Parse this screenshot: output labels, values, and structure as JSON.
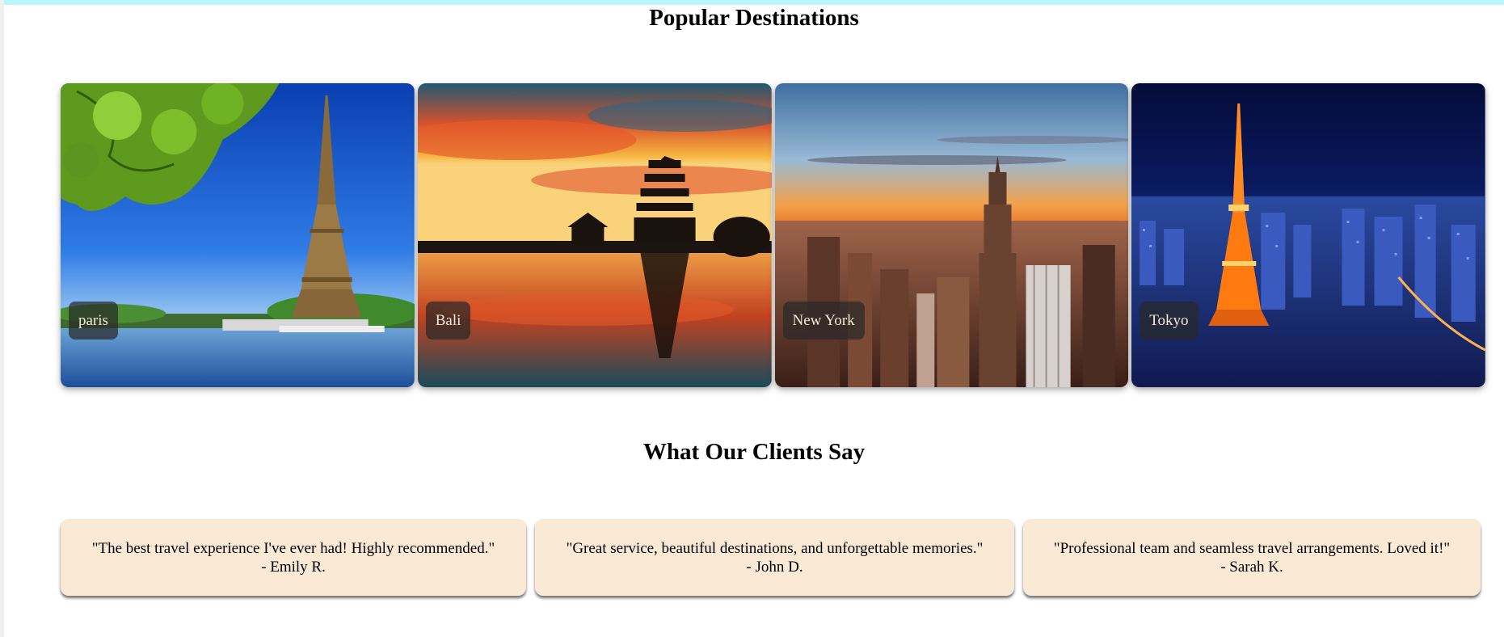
{
  "sections": {
    "destinations_title": "Popular Destinations",
    "testimonials_title": "What Our Clients Say"
  },
  "destinations": [
    {
      "name": "paris",
      "image": "eiffel-tower-photo"
    },
    {
      "name": "Bali",
      "image": "sunset-temple-photo"
    },
    {
      "name": "New York",
      "image": "skyline-photo"
    },
    {
      "name": "Tokyo",
      "image": "tokyo-tower-night-photo"
    }
  ],
  "testimonials": [
    {
      "quote": "\"The best travel experience I've ever had! Highly recommended.\"",
      "author": "- Emily R."
    },
    {
      "quote": "\"Great service, beautiful destinations, and unforgettable memories.\"",
      "author": "- John D."
    },
    {
      "quote": "\"Professional team and seamless travel arrangements. Loved it!\"",
      "author": "- Sarah K."
    }
  ],
  "colors": {
    "top_strip": "#b9f6f7",
    "testimonial_bg": "#fae9d5",
    "label_bg": "rgba(40,40,40,0.72)"
  }
}
